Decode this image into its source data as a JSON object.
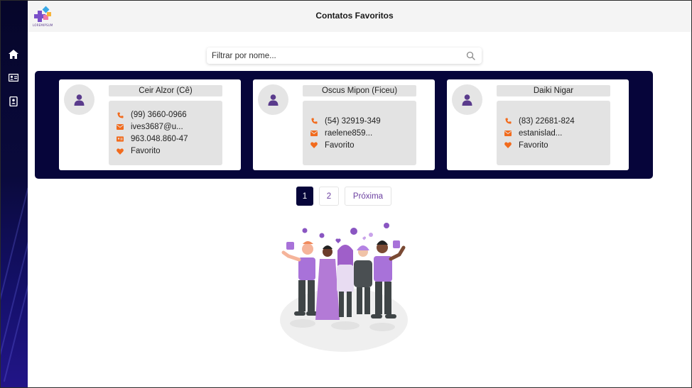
{
  "app": {
    "logo_text": "LOREMIPSUM"
  },
  "header": {
    "title": "Contatos Favoritos"
  },
  "sidebar": {
    "items": [
      {
        "icon": "home-icon"
      },
      {
        "icon": "contact-card-icon"
      },
      {
        "icon": "address-book-icon"
      }
    ]
  },
  "search": {
    "placeholder": "Filtrar por nome...",
    "value": ""
  },
  "contacts": [
    {
      "name": "Ceir Alzor (Cê)",
      "phone": "(99) 3660-0966",
      "email": "ives3687@u...",
      "document": "963.048.860-47",
      "favorite": "Favorito"
    },
    {
      "name": "Oscus Mipon (Ficeu)",
      "phone": "(54) 32919-349",
      "email": "raelene859...",
      "favorite": "Favorito"
    },
    {
      "name": "Daiki Nigar",
      "phone": "(83) 22681-824",
      "email": "estanislad...",
      "favorite": "Favorito"
    }
  ],
  "pagination": {
    "pages": [
      "1",
      "2"
    ],
    "current": "1",
    "next_label": "Próxima"
  },
  "colors": {
    "accent": "#06053a",
    "icon_orange": "#f26b1d",
    "avatar_purple": "#5a3b8c",
    "link_purple": "#6b3fa0"
  }
}
